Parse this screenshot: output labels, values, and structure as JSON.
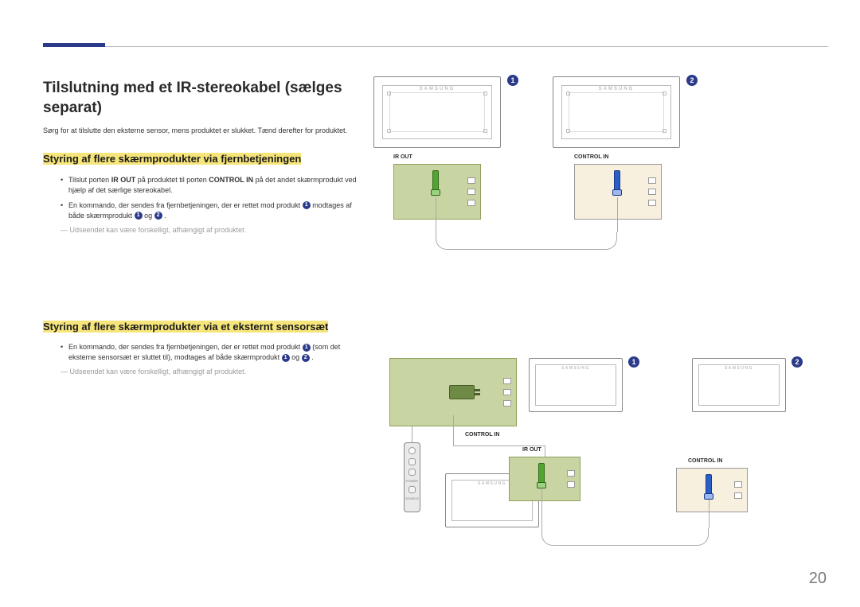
{
  "page_number": "20",
  "title": "Tilslutning med et IR-stereokabel (sælges separat)",
  "intro": "Sørg for at tilslutte den eksterne sensor, mens produktet er slukket. Tænd derefter for produktet.",
  "section1": {
    "heading": "Styring af flere skærmprodukter via fjernbetjeningen",
    "bullet1_pre": "Tilslut porten ",
    "bullet1_bold1": "IR OUT",
    "bullet1_mid": " på produktet til porten ",
    "bullet1_bold2": "CONTROL IN",
    "bullet1_post": " på det andet skærmprodukt ved hjælp af det særlige stereokabel.",
    "bullet2_pre": "En kommando, der sendes fra fjernbetjeningen, der er rettet mod produkt ",
    "bullet2_mid": " modtages af både skærmprodukt ",
    "bullet2_and": " og ",
    "bullet2_end": ".",
    "note": "Udseendet kan være forskelligt, afhængigt af produktet."
  },
  "section2": {
    "heading": "Styring af flere skærmprodukter via et eksternt sensorsæt",
    "bullet1_pre": "En kommando, der sendes fra fjernbetjeningen, der er rettet mod produkt ",
    "bullet1_mid": " (som det eksterne sensorsæt er sluttet til), modtages af både skærmprodukt ",
    "bullet1_and": " og ",
    "bullet1_end": ".",
    "note": "Udseendet kan være forskelligt, afhængigt af produktet."
  },
  "labels": {
    "ir_out": "IR OUT",
    "control_in": "CONTROL IN",
    "brand": "SAMSUNG",
    "one": "1",
    "two": "2",
    "remote_power": "POWER",
    "remote_source": "SOURCE"
  }
}
